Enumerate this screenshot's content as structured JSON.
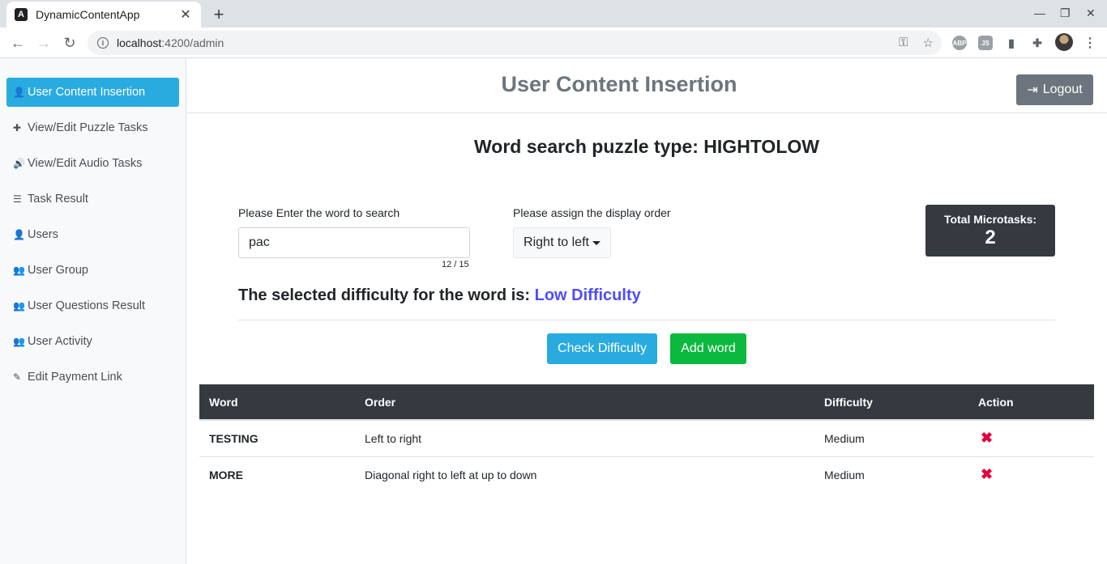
{
  "browser": {
    "tab_title": "DynamicContentApp",
    "tab_favicon": "A",
    "url_host": "localhost",
    "url_path": ":4200/admin",
    "extensions": [
      "ABP",
      "JS"
    ]
  },
  "sidebar": {
    "items": [
      {
        "label": "User Content Insertion",
        "icon": "user-plus-icon",
        "glyph": "👤",
        "active": true
      },
      {
        "label": "View/Edit Puzzle Tasks",
        "icon": "puzzle-icon",
        "glyph": "✚"
      },
      {
        "label": "View/Edit Audio Tasks",
        "icon": "volume-icon",
        "glyph": "🔊"
      },
      {
        "label": "Task Result",
        "icon": "list-icon",
        "glyph": "☰"
      },
      {
        "label": "Users",
        "icon": "user-icon",
        "glyph": "👤"
      },
      {
        "label": "User Group",
        "icon": "users-icon",
        "glyph": "👥"
      },
      {
        "label": "User Questions Result",
        "icon": "users-icon",
        "glyph": "👥"
      },
      {
        "label": "User Activity",
        "icon": "users-icon",
        "glyph": "👥"
      },
      {
        "label": "Edit Payment Link",
        "icon": "edit-icon",
        "glyph": "✎"
      }
    ]
  },
  "header": {
    "title": "User Content Insertion",
    "logout_label": "Logout"
  },
  "main": {
    "puzzle_title": "Word search puzzle type: HIGHTOLOW",
    "word_label": "Please Enter the word to search",
    "word_value": "pac",
    "word_counter": "12 / 15",
    "order_label": "Please assign the display order",
    "order_value": "Right to left",
    "total_label": "Total Microtasks:",
    "total_value": "2",
    "difficulty_prefix": "The selected difficulty for the word is:",
    "difficulty_value": "Low Difficulty",
    "check_label": "Check Difficulty",
    "add_label": "Add word"
  },
  "table": {
    "headers": [
      "Word",
      "Order",
      "Difficulty",
      "Action"
    ],
    "rows": [
      {
        "word": "TESTING",
        "order": "Left to right",
        "difficulty": "Medium"
      },
      {
        "word": "MORE",
        "order": "Diagonal right to left at up to down",
        "difficulty": "Medium"
      }
    ]
  },
  "colors": {
    "accent": "#29abe0",
    "success": "#0ab93e",
    "danger": "#e3003c",
    "dark": "#343a40",
    "difficulty_text": "#4d4dff"
  }
}
